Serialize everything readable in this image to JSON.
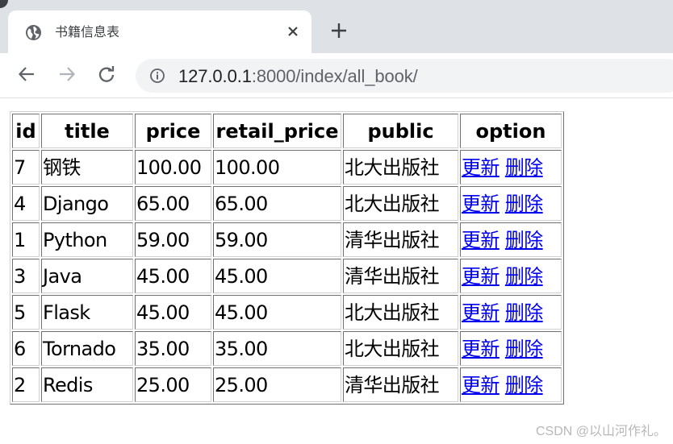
{
  "browser": {
    "tab": {
      "title": "书籍信息表",
      "icon": "globe-icon"
    },
    "new_tab_icon": "plus-icon",
    "close_tab_icon": "close-icon",
    "nav": {
      "back": "back-arrow-icon",
      "forward": "forward-arrow-icon",
      "reload": "reload-icon"
    },
    "address_bar": {
      "icon": "info-icon",
      "host": "127.0.0.1",
      "rest": ":8000/index/all_book/"
    }
  },
  "table": {
    "headers": [
      "id",
      "title",
      "price",
      "retail_price",
      "public",
      "option"
    ],
    "rows": [
      {
        "id": "7",
        "title": "钢铁",
        "price": "100.00",
        "retail_price": "100.00",
        "public": "北大出版社",
        "update": "更新",
        "delete": "删除"
      },
      {
        "id": "4",
        "title": "Django",
        "price": "65.00",
        "retail_price": "65.00",
        "public": "北大出版社",
        "update": "更新",
        "delete": "删除"
      },
      {
        "id": "1",
        "title": "Python",
        "price": "59.00",
        "retail_price": "59.00",
        "public": "清华出版社",
        "update": "更新",
        "delete": "删除"
      },
      {
        "id": "3",
        "title": "Java",
        "price": "45.00",
        "retail_price": "45.00",
        "public": "清华出版社",
        "update": "更新",
        "delete": "删除"
      },
      {
        "id": "5",
        "title": "Flask",
        "price": "45.00",
        "retail_price": "45.00",
        "public": "北大出版社",
        "update": "更新",
        "delete": "删除"
      },
      {
        "id": "6",
        "title": "Tornado",
        "price": "35.00",
        "retail_price": "35.00",
        "public": "北大出版社",
        "update": "更新",
        "delete": "删除"
      },
      {
        "id": "2",
        "title": "Redis",
        "price": "25.00",
        "retail_price": "25.00",
        "public": "清华出版社",
        "update": "更新",
        "delete": "删除"
      }
    ]
  },
  "watermark": "CSDN @以山河作礼。",
  "colors": {
    "link": "#0000ee",
    "tabstrip": "#dee1e6",
    "omnibox": "#f1f3f4"
  }
}
